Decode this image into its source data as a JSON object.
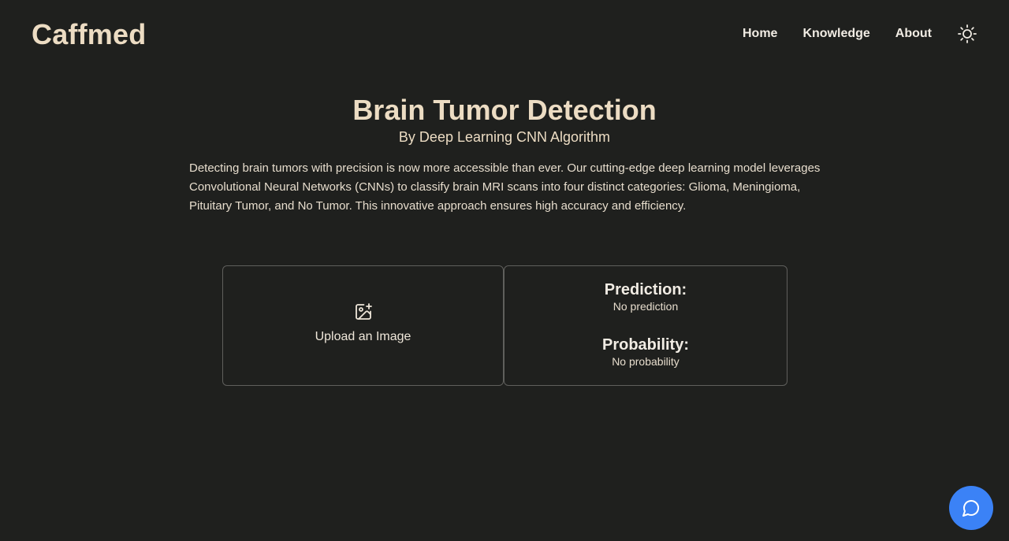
{
  "header": {
    "brand": "Caffmed",
    "nav": {
      "home": "Home",
      "knowledge": "Knowledge",
      "about": "About"
    },
    "theme_icon": "sun-icon"
  },
  "hero": {
    "title": "Brain Tumor Detection",
    "subtitle": "By Deep Learning CNN Algorithm",
    "description": "Detecting brain tumors with precision is now more accessible than ever. Our cutting-edge deep learning model leverages Convolutional Neural Networks (CNNs) to classify brain MRI scans into four distinct categories: Glioma, Meningioma, Pituitary Tumor, and No Tumor. This innovative approach ensures high accuracy and efficiency."
  },
  "upload": {
    "icon": "image-plus-icon",
    "label": "Upload an Image"
  },
  "result": {
    "prediction_heading": "Prediction:",
    "prediction_value": "No prediction",
    "probability_heading": "Probability:",
    "probability_value": "No probability"
  },
  "chat": {
    "icon": "chat-bubble-icon"
  },
  "colors": {
    "background": "#1f201e",
    "brand_text": "#ecdcc3",
    "accent": "#3b82f6",
    "card_border": "#5f5f5c"
  }
}
